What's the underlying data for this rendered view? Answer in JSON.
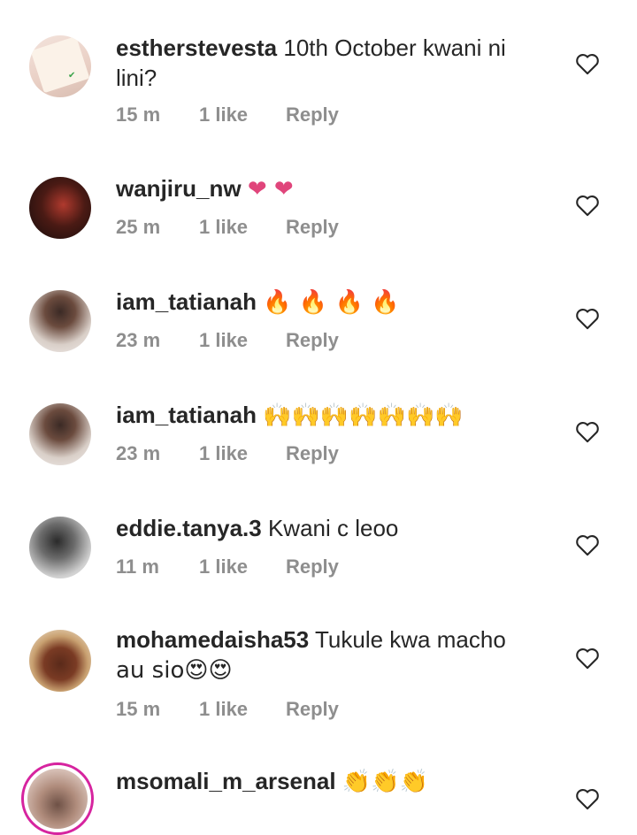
{
  "comments": [
    {
      "username": "estherstevesta",
      "text": "10th October kwani ni",
      "text2": "lini?",
      "time": "15 m",
      "likes": "1 like",
      "reply": "Reply",
      "avatar_text": "Anywhere you find"
    },
    {
      "username": "wanjiru_nw",
      "text": "❤ ❤",
      "time": "25 m",
      "likes": "1 like",
      "reply": "Reply"
    },
    {
      "username": "iam_tatianah",
      "text": "🔥 🔥 🔥 🔥",
      "time": "23 m",
      "likes": "1 like",
      "reply": "Reply"
    },
    {
      "username": "iam_tatianah",
      "text": "🙌🙌🙌🙌🙌🙌🙌",
      "time": "23 m",
      "likes": "1 like",
      "reply": "Reply"
    },
    {
      "username": "eddie.tanya.3",
      "text": "Kwani c leoo",
      "time": "11 m",
      "likes": "1 like",
      "reply": "Reply"
    },
    {
      "username": "mohamedaisha53",
      "text": "Tukule kwa macho",
      "text2": "au sio😍😍",
      "time": "15 m",
      "likes": "1 like",
      "reply": "Reply"
    },
    {
      "username": "msomali_m_arsenal",
      "text": "👏👏👏"
    }
  ],
  "colors": {
    "username": "#262626",
    "meta": "#8e8e8e",
    "heart_emoji": "#e0457b",
    "fire": "#f5511e",
    "clap": "#f4b400",
    "story_ring": "#d6249f"
  },
  "icons": {
    "like": "heart-outline-icon"
  }
}
